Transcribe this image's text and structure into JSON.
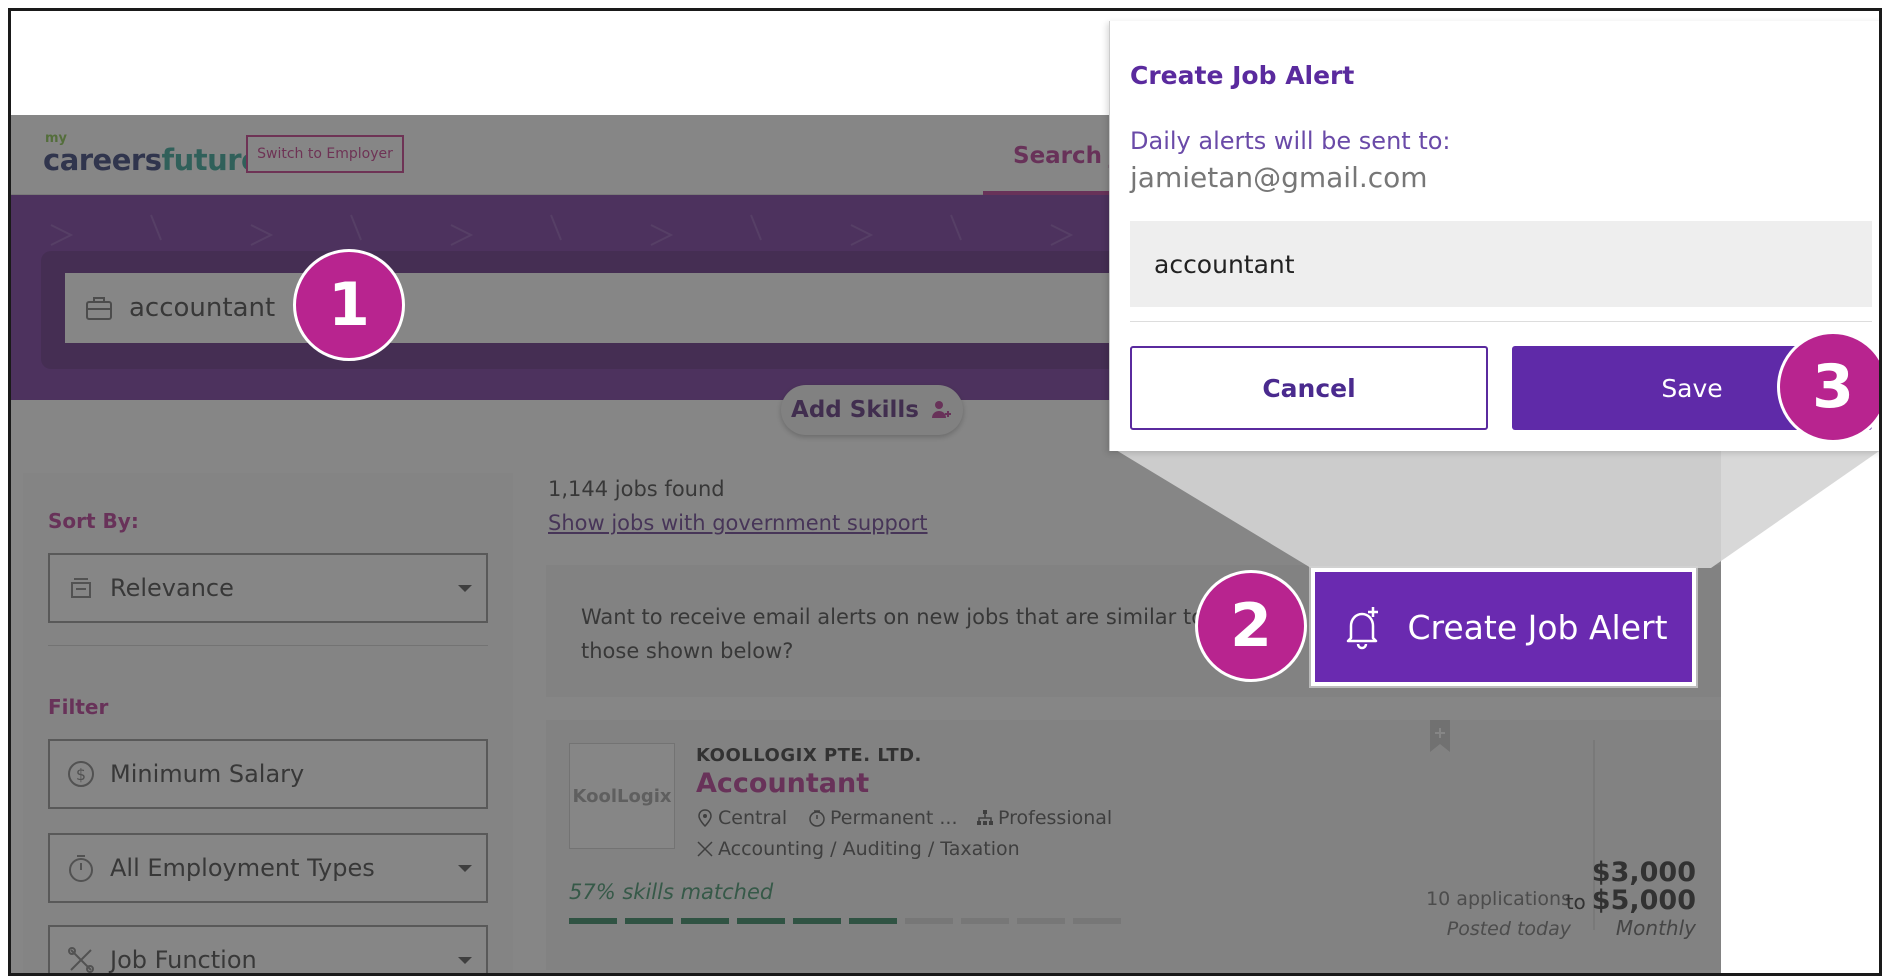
{
  "header": {
    "logo_small": "my",
    "logo_main_a": "careers",
    "logo_main_b": "future",
    "switch_employer": "Switch to Employer",
    "nav_search": "Search Jobs"
  },
  "search": {
    "value": "accountant",
    "add_skills": "Add Skills"
  },
  "sidebar": {
    "sort_label": "Sort By:",
    "sort_value": "Relevance",
    "filter_label": "Filter",
    "min_salary": "Minimum Salary",
    "employment_types": "All Employment Types",
    "job_function": "Job Function"
  },
  "results": {
    "count": "1,144 jobs found",
    "gov_link": "Show jobs with government support",
    "alert_prompt": "Want to receive email alerts on new jobs that are similar to those shown below?",
    "create_alert": "Create Job Alert"
  },
  "job": {
    "company_logo_text": "KoolLogix",
    "company": "KOOLLOGIX PTE. LTD.",
    "title": "Accountant",
    "location": "Central",
    "employment": "Permanent ...",
    "level": "Professional",
    "category": "Accounting / Auditing / Taxation",
    "skills_matched": "57% skills matched",
    "skills_matched_fraction": 0.57,
    "applications": "10 applications",
    "posted": "Posted today",
    "salary_from": "$3,000",
    "salary_to_prefix": "to",
    "salary_to": "$5,000",
    "salary_period": "Monthly"
  },
  "popup": {
    "title": "Create Job Alert",
    "subtitle": "Daily alerts will be sent to:",
    "email": "jamietan@gmail.com",
    "keyword": "accountant",
    "cancel": "Cancel",
    "save": "Save"
  },
  "steps": [
    "1",
    "2",
    "3"
  ],
  "colors": {
    "brand_purple": "#6a2396",
    "accent_magenta": "#b8248f",
    "button_purple": "#5f2aa8",
    "skill_green": "#1f7a50"
  }
}
